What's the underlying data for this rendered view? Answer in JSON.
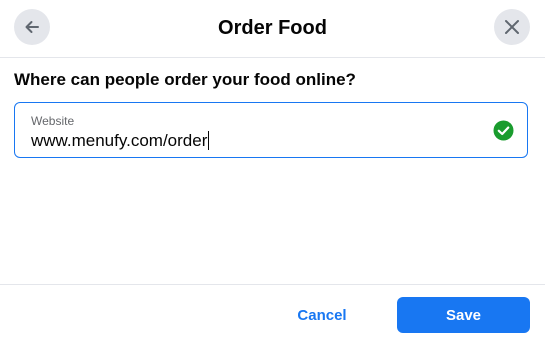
{
  "dialog": {
    "title": "Order Food"
  },
  "form": {
    "question": "Where can people order your food online?",
    "website_label": "Website",
    "website_value": "www.menufy.com/order",
    "valid": true
  },
  "footer": {
    "cancel_label": "Cancel",
    "save_label": "Save"
  },
  "icons": {
    "back": "arrow-left-icon",
    "close": "close-icon",
    "valid": "check-circle-icon"
  },
  "colors": {
    "accent": "#1877f2",
    "success": "#1a9c2e",
    "icon_bg": "#e4e6eb",
    "muted_text": "#65676b"
  }
}
